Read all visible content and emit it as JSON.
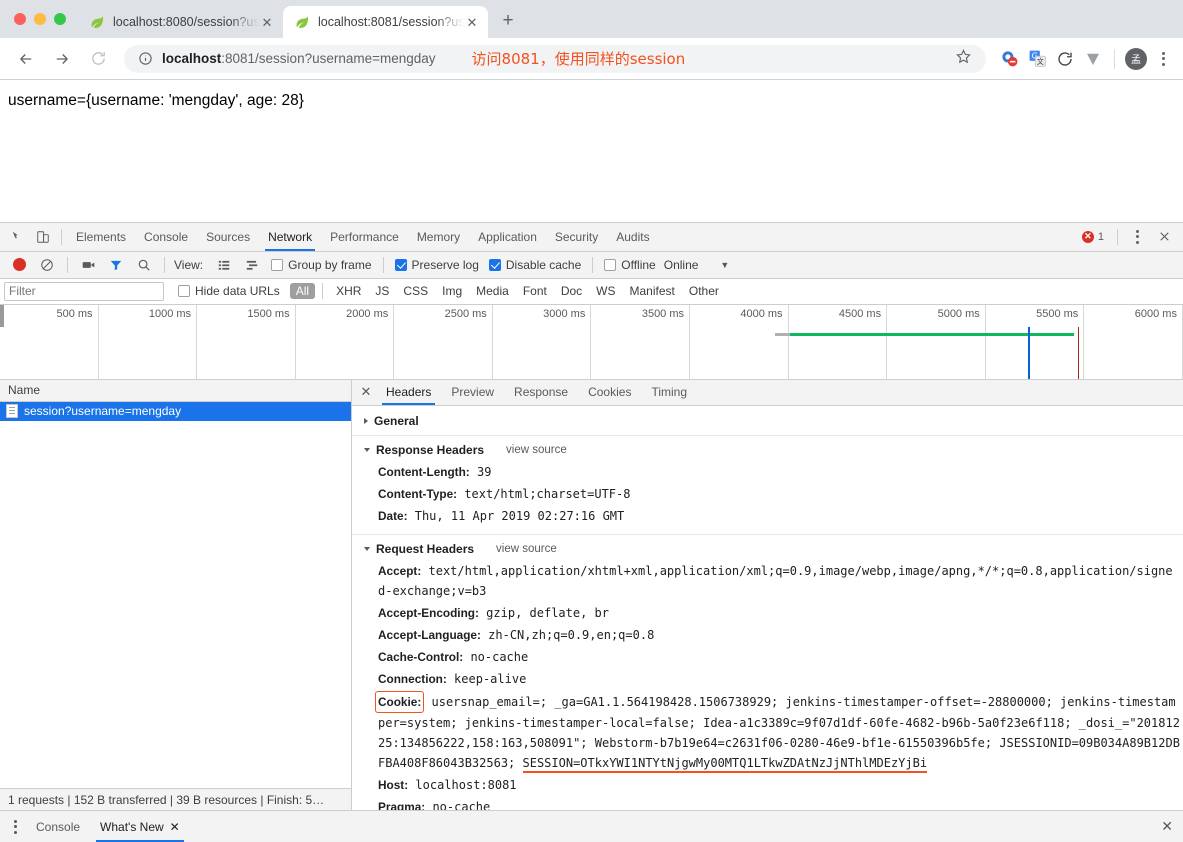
{
  "browser": {
    "tabs": [
      {
        "title": "localhost:8080/session?userna",
        "favicon": "spring-leaf-icon",
        "active": false
      },
      {
        "title": "localhost:8081/session?userna",
        "favicon": "spring-leaf-icon",
        "active": true
      }
    ],
    "new_tab_label": "+",
    "address": {
      "scheme_prefix": "localhost",
      "url_rest": ":8081/session?username=mengday",
      "full_url": "localhost:8081/session?username=mengday",
      "security_icon": "info-circle-icon"
    },
    "annotation": "访问8081，使用同样的session",
    "avatar_label": "孟",
    "extensions": [
      "adblock-icon",
      "google-translate-icon",
      "refresh-extension-icon",
      "v-extension-icon"
    ]
  },
  "page": {
    "body_text": "username={username: 'mengday', age: 28}"
  },
  "devtools": {
    "panels": [
      "Elements",
      "Console",
      "Sources",
      "Network",
      "Performance",
      "Memory",
      "Application",
      "Security",
      "Audits"
    ],
    "selected_panel": "Network",
    "error_count": "1",
    "toolbar": {
      "view_label": "View:",
      "group_by_frame": "Group by frame",
      "group_by_frame_checked": false,
      "preserve_log": "Preserve log",
      "preserve_log_checked": true,
      "disable_cache": "Disable cache",
      "disable_cache_checked": true,
      "offline": "Offline",
      "offline_checked": false,
      "throttling": "Online"
    },
    "filter": {
      "placeholder": "Filter",
      "value": "",
      "hide_data_urls": "Hide data URLs",
      "hide_data_urls_checked": false,
      "types": [
        "All",
        "XHR",
        "JS",
        "CSS",
        "Img",
        "Media",
        "Font",
        "Doc",
        "WS",
        "Manifest",
        "Other"
      ],
      "selected_type": "All"
    },
    "timeline": {
      "ticks": [
        "500 ms",
        "1000 ms",
        "1500 ms",
        "2000 ms",
        "2500 ms",
        "3000 ms",
        "3500 ms",
        "4000 ms",
        "4500 ms",
        "5000 ms",
        "5500 ms",
        "6000 ms"
      ],
      "bars": [
        {
          "name": "wait-bar",
          "color": "#b0b0b0",
          "start_pct": 65.5,
          "width_pct": 1.3
        },
        {
          "name": "load-bar",
          "color": "#0eb760",
          "start_pct": 66.8,
          "width_pct": 24.0
        }
      ],
      "markers": [
        {
          "name": "dom-content-loaded-marker",
          "color": "#0b5fd0",
          "pos_pct": 86.9
        },
        {
          "name": "load-event-marker",
          "color": "#a52714",
          "pos_pct": 91.1
        }
      ]
    },
    "requests": {
      "column_header": "Name",
      "rows": [
        {
          "name": "session?username=mengday",
          "selected": true
        }
      ]
    },
    "detail": {
      "tabs": [
        "Headers",
        "Preview",
        "Response",
        "Cookies",
        "Timing"
      ],
      "selected_tab": "Headers",
      "sections": {
        "general_title": "General",
        "response_title": "Response Headers",
        "request_title": "Request Headers",
        "view_source": "view source"
      },
      "response_headers": [
        {
          "key": "Content-Length:",
          "value": "39"
        },
        {
          "key": "Content-Type:",
          "value": "text/html;charset=UTF-8"
        },
        {
          "key": "Date:",
          "value": "Thu, 11 Apr 2019 02:27:16 GMT"
        }
      ],
      "request_headers": [
        {
          "key": "Accept:",
          "value": "text/html,application/xhtml+xml,application/xml;q=0.9,image/webp,image/apng,*/*;q=0.8,application/signed-exchange;v=b3"
        },
        {
          "key": "Accept-Encoding:",
          "value": "gzip, deflate, br"
        },
        {
          "key": "Accept-Language:",
          "value": "zh-CN,zh;q=0.9,en;q=0.8"
        },
        {
          "key": "Cache-Control:",
          "value": "no-cache"
        },
        {
          "key": "Connection:",
          "value": "keep-alive"
        }
      ],
      "cookie_header": {
        "key": "Cookie:",
        "value_prefix": "usersnap_email=; _ga=GA1.1.564198428.1506738929; jenkins-timestamper-offset=-28800000; jenkins-timestamper=system; jenkins-timestamper-local=false; Idea-a1c3389c=9f07d1df-60fe-4682-b96b-5a0f23e6f118; _dosi_=\"20181225:134856222,158:163,508091\"; Webstorm-b7b19e64=c2631f06-0280-46e9-bf1e-61550396b5fe; JSESSIONID=09B034A89B12DBFBA408F86043B32563; ",
        "session_part": "SESSION=OTkxYWI1NTYtNjgwMy00MTQ1LTkwZDAtNzJjNThlMDEzYjBi"
      },
      "trailing_headers": [
        {
          "key": "Host:",
          "value": "localhost:8081"
        },
        {
          "key": "Pragma:",
          "value": "no-cache"
        }
      ]
    },
    "status_bar": "1 requests | 152 B transferred | 39 B resources | Finish: 5…",
    "drawer": {
      "tabs": [
        "Console",
        "What's New"
      ],
      "selected_tab": "What's New"
    }
  },
  "colors": {
    "accent": "#1a73e8",
    "annotation": "#f4511e",
    "error": "#d93025",
    "load_bar": "#0eb760"
  }
}
